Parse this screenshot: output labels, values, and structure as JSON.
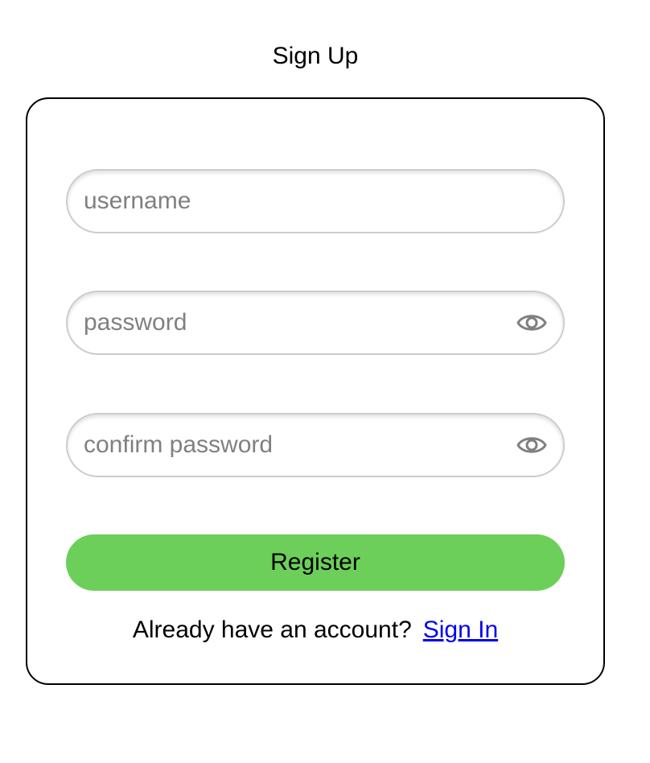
{
  "page": {
    "title": "Sign Up"
  },
  "form": {
    "username": {
      "value": "",
      "placeholder": "username"
    },
    "password": {
      "value": "",
      "placeholder": "password",
      "toggle_icon": "eye-icon"
    },
    "confirm_password": {
      "value": "",
      "placeholder": "confirm password",
      "toggle_icon": "eye-icon"
    },
    "register_label": "Register",
    "signin_prompt": "Already have an account?",
    "signin_link": "Sign In"
  },
  "colors": {
    "accent": "#6ccf59",
    "link": "#0000ee",
    "input_border": "#cccccc",
    "placeholder": "#808080",
    "card_border": "#000000"
  }
}
